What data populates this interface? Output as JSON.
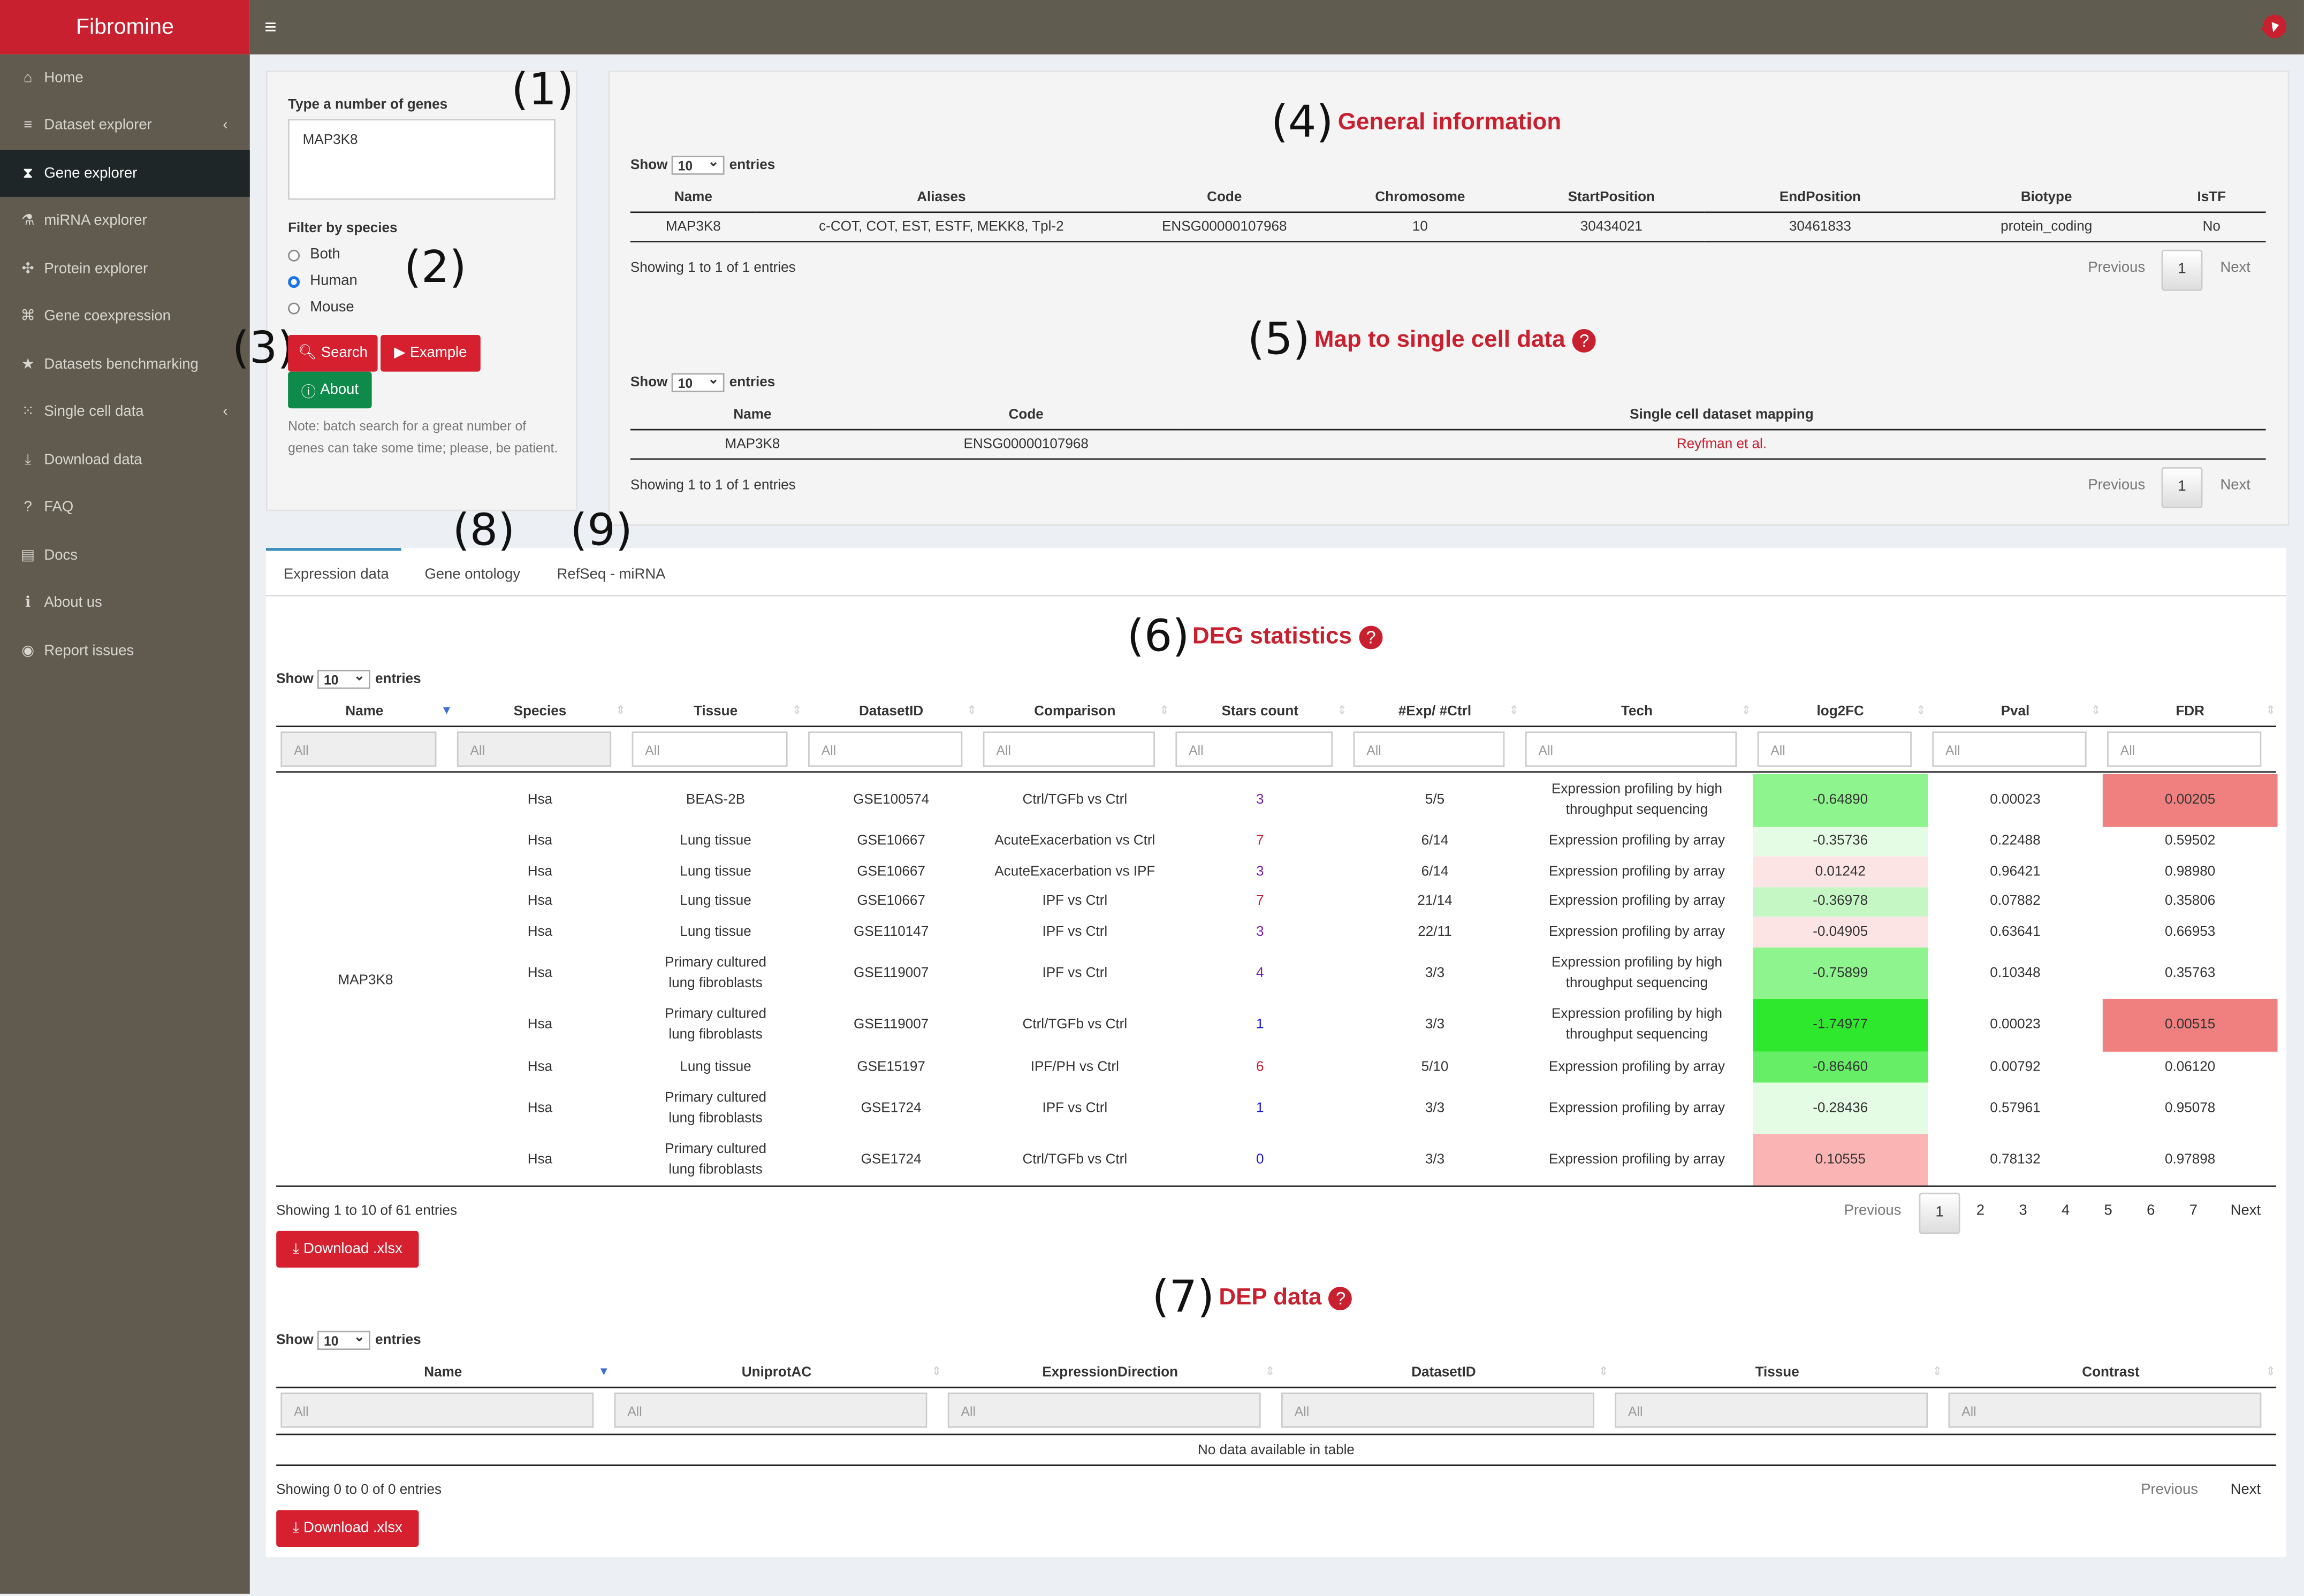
{
  "app": {
    "title": "Fibromine"
  },
  "sidebar": {
    "items": [
      {
        "label": "Home",
        "icon": "home-icon",
        "glyph": "⌂"
      },
      {
        "label": "Dataset explorer",
        "icon": "database-icon",
        "glyph": "≡",
        "chevron": true
      },
      {
        "label": "Gene explorer",
        "icon": "hourglass-icon",
        "glyph": "⧗",
        "active": true
      },
      {
        "label": "miRNA explorer",
        "icon": "flask-icon",
        "glyph": "⚗"
      },
      {
        "label": "Protein explorer",
        "icon": "molecule-icon",
        "glyph": "✣"
      },
      {
        "label": "Gene coexpression",
        "icon": "network-icon",
        "glyph": "⌘"
      },
      {
        "label": "Datasets benchmarking",
        "icon": "star-icon",
        "glyph": "★"
      },
      {
        "label": "Single cell data",
        "icon": "grid-icon",
        "glyph": "⁙",
        "chevron": true
      },
      {
        "label": "Download data",
        "icon": "download-icon",
        "glyph": "⤓"
      },
      {
        "label": "FAQ",
        "icon": "question-icon",
        "glyph": "?"
      },
      {
        "label": "Docs",
        "icon": "book-icon",
        "glyph": "▤"
      },
      {
        "label": "About us",
        "icon": "info-icon",
        "glyph": "ℹ"
      },
      {
        "label": "Report issues",
        "icon": "github-icon",
        "glyph": "◉"
      }
    ]
  },
  "annotations": {
    "a1": "(1)",
    "a2": "(2)",
    "a3": "(3)",
    "a4": "(4)",
    "a5": "(5)",
    "a6": "(6)",
    "a7": "(7)",
    "a8": "(8)",
    "a9": "(9)"
  },
  "search": {
    "label": "Type a number of genes",
    "value": "MAP3K8",
    "filter_label": "Filter by species",
    "species": [
      "Both",
      "Human",
      "Mouse"
    ],
    "selected_species": "Human",
    "search_btn": "Search",
    "example_btn": "Example",
    "about_btn": "About",
    "note": "Note: batch search for a great number of genes can take some time; please, be patient."
  },
  "general": {
    "title": "General information",
    "show": "Show",
    "entries": "entries",
    "length": "10",
    "columns": [
      "Name",
      "Aliases",
      "Code",
      "Chromosome",
      "StartPosition",
      "EndPosition",
      "Biotype",
      "IsTF"
    ],
    "rows": [
      [
        "MAP3K8",
        "c-COT, COT, EST, ESTF, MEKK8, Tpl-2",
        "ENSG00000107968",
        "10",
        "30434021",
        "30461833",
        "protein_coding",
        "No"
      ]
    ],
    "info": "Showing 1 to 1 of 1 entries",
    "prev": "Previous",
    "page": "1",
    "next": "Next"
  },
  "singlecell": {
    "title": "Map to single cell data",
    "show": "Show",
    "entries": "entries",
    "length": "10",
    "columns": [
      "Name",
      "Code",
      "Single cell dataset mapping"
    ],
    "rows": [
      [
        "MAP3K8",
        "ENSG00000107968",
        "Reyfman et al."
      ]
    ],
    "info": "Showing 1 to 1 of 1 entries",
    "prev": "Previous",
    "page": "1",
    "next": "Next"
  },
  "tabs": [
    "Expression data",
    "Gene ontology",
    "RefSeq - miRNA"
  ],
  "deg": {
    "title": "DEG statistics",
    "show": "Show",
    "entries": "entries",
    "length": "10",
    "columns": [
      "Name",
      "Species",
      "Tissue",
      "DatasetID",
      "Comparison",
      "Stars count",
      "#Exp/ #Ctrl",
      "Tech",
      "log2FC",
      "Pval",
      "FDR"
    ],
    "filter_placeholder": "All",
    "gene": "MAP3K8",
    "rows": [
      {
        "species": "Hsa",
        "tissue": "BEAS-2B",
        "dataset": "GSE100574",
        "comparison": "Ctrl/TGFb vs Ctrl",
        "stars": "3",
        "expctrl": "5/5",
        "tech": "Expression profiling by high throughput sequencing",
        "log2fc": "-0.64890",
        "pval": "0.00023",
        "fdr": "0.00205",
        "fc_color": "#8ef58e",
        "fdr_color": "#f08080"
      },
      {
        "species": "Hsa",
        "tissue": "Lung tissue",
        "dataset": "GSE10667",
        "comparison": "AcuteExacerbation vs Ctrl",
        "stars": "7",
        "expctrl": "6/14",
        "tech": "Expression profiling by array",
        "log2fc": "-0.35736",
        "pval": "0.22488",
        "fdr": "0.59502",
        "fc_color": "#e4fbe4",
        "fdr_color": ""
      },
      {
        "species": "Hsa",
        "tissue": "Lung tissue",
        "dataset": "GSE10667",
        "comparison": "AcuteExacerbation vs IPF",
        "stars": "3",
        "expctrl": "6/14",
        "tech": "Expression profiling by array",
        "log2fc": "0.01242",
        "pval": "0.96421",
        "fdr": "0.98980",
        "fc_color": "#fde4e4",
        "fdr_color": ""
      },
      {
        "species": "Hsa",
        "tissue": "Lung tissue",
        "dataset": "GSE10667",
        "comparison": "IPF vs Ctrl",
        "stars": "7",
        "expctrl": "21/14",
        "tech": "Expression profiling by array",
        "log2fc": "-0.36978",
        "pval": "0.07882",
        "fdr": "0.35806",
        "fc_color": "#c5f7c5",
        "fdr_color": ""
      },
      {
        "species": "Hsa",
        "tissue": "Lung tissue",
        "dataset": "GSE110147",
        "comparison": "IPF vs Ctrl",
        "stars": "3",
        "expctrl": "22/11",
        "tech": "Expression profiling by array",
        "log2fc": "-0.04905",
        "pval": "0.63641",
        "fdr": "0.66953",
        "fc_color": "#fde4e4",
        "fdr_color": ""
      },
      {
        "species": "Hsa",
        "tissue": "Primary cultured lung fibroblasts",
        "dataset": "GSE119007",
        "comparison": "IPF vs Ctrl",
        "stars": "4",
        "expctrl": "3/3",
        "tech": "Expression profiling by high throughput sequencing",
        "log2fc": "-0.75899",
        "pval": "0.10348",
        "fdr": "0.35763",
        "fc_color": "#8ef58e",
        "fdr_color": ""
      },
      {
        "species": "Hsa",
        "tissue": "Primary cultured lung fibroblasts",
        "dataset": "GSE119007",
        "comparison": "Ctrl/TGFb vs Ctrl",
        "stars": "1",
        "expctrl": "3/3",
        "tech": "Expression profiling by high throughput sequencing",
        "log2fc": "-1.74977",
        "pval": "0.00023",
        "fdr": "0.00515",
        "fc_color": "#2ee82e",
        "fdr_color": "#f08080"
      },
      {
        "species": "Hsa",
        "tissue": "Lung tissue",
        "dataset": "GSE15197",
        "comparison": "IPF/PH vs Ctrl",
        "stars": "6",
        "expctrl": "5/10",
        "tech": "Expression profiling by array",
        "log2fc": "-0.86460",
        "pval": "0.00792",
        "fdr": "0.06120",
        "fc_color": "#66ee66",
        "fdr_color": ""
      },
      {
        "species": "Hsa",
        "tissue": "Primary cultured lung fibroblasts",
        "dataset": "GSE1724",
        "comparison": "IPF vs Ctrl",
        "stars": "1",
        "expctrl": "3/3",
        "tech": "Expression profiling by array",
        "log2fc": "-0.28436",
        "pval": "0.57961",
        "fdr": "0.95078",
        "fc_color": "#e4fbe4",
        "fdr_color": ""
      },
      {
        "species": "Hsa",
        "tissue": "Primary cultured lung fibroblasts",
        "dataset": "GSE1724",
        "comparison": "Ctrl/TGFb vs Ctrl",
        "stars": "0",
        "expctrl": "3/3",
        "tech": "Expression profiling by array",
        "log2fc": "0.10555",
        "pval": "0.78132",
        "fdr": "0.97898",
        "fc_color": "#fbb4b4",
        "fdr_color": ""
      }
    ],
    "info": "Showing 1 to 10 of 61 entries",
    "prev": "Previous",
    "pages": [
      "1",
      "2",
      "3",
      "4",
      "5",
      "6",
      "7"
    ],
    "next": "Next",
    "download": "Download .xlsx"
  },
  "dep": {
    "title": "DEP data",
    "show": "Show",
    "entries": "entries",
    "length": "10",
    "columns": [
      "Name",
      "UniprotAC",
      "ExpressionDirection",
      "DatasetID",
      "Tissue",
      "Contrast"
    ],
    "filter_placeholder": "All",
    "empty": "No data available in table",
    "info": "Showing 0 to 0 of 0 entries",
    "prev": "Previous",
    "next": "Next",
    "download": "Download .xlsx"
  }
}
